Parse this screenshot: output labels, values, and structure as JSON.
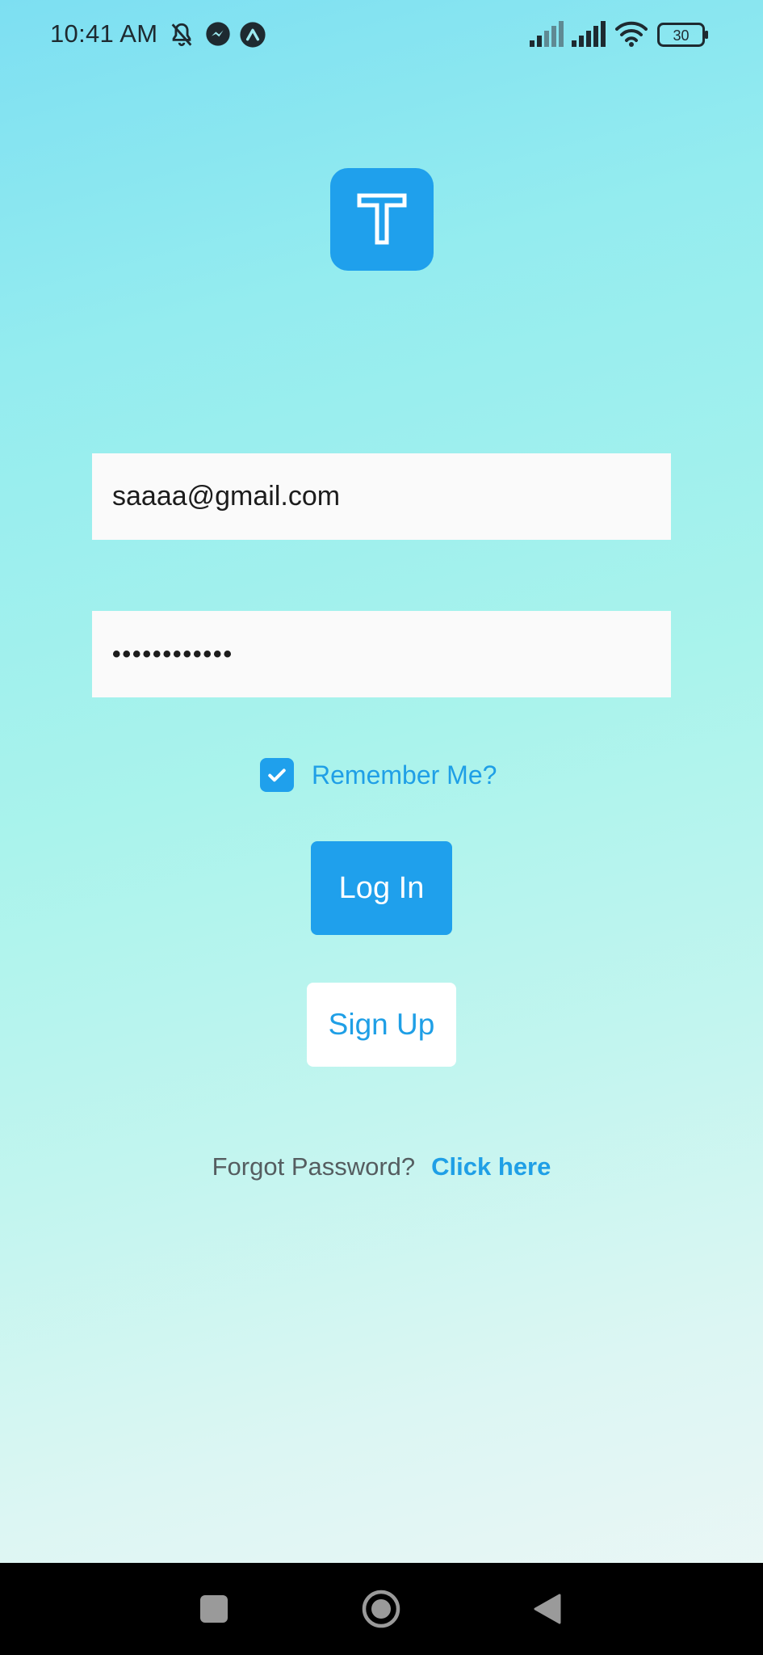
{
  "status_bar": {
    "time": "10:41 AM",
    "battery": "30",
    "icons": [
      "bell-off-icon",
      "messenger-icon",
      "app-notification-icon",
      "signal-icon",
      "signal-icon",
      "wifi-icon",
      "battery-icon"
    ]
  },
  "logo": {
    "icon": "app-logo-t-icon",
    "color": "#1fa0ec"
  },
  "login_form": {
    "email_value": "saaaa@gmail.com",
    "password_value": "••••••••••••",
    "remember_label": "Remember Me?",
    "remember_checked": true,
    "login_label": "Log In",
    "signup_label": "Sign Up",
    "forgot_text": "Forgot Password?",
    "forgot_link": "Click here"
  },
  "colors": {
    "accent": "#1fa0ec",
    "text_dark": "#1c1c1c",
    "text_muted": "#555d60"
  },
  "nav_bar": {
    "icons": [
      "recents-icon",
      "home-icon",
      "back-icon"
    ]
  }
}
